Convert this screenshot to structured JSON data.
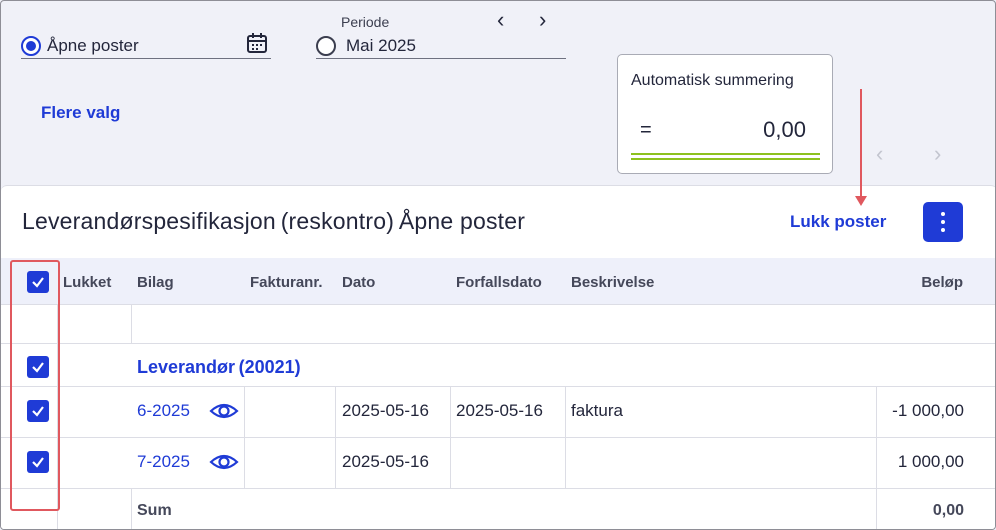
{
  "filters": {
    "open_posts_label": "Åpne poster",
    "period_caption": "Periode",
    "period_value": "Mai 2025",
    "more_options": "Flere valg"
  },
  "summary": {
    "title": "Automatisk summering",
    "operator": "=",
    "value": "0,00"
  },
  "panel": {
    "title": "Leverandørspesifikasjon (reskontro) Åpne poster",
    "close_posts": "Lukk poster"
  },
  "columns": [
    "Lukket",
    "Bilag",
    "Fakturanr.",
    "Dato",
    "Forfallsdato",
    "Beskrivelse",
    "Beløp"
  ],
  "group": {
    "label": "Leverandør (20021)"
  },
  "rows": [
    {
      "bilag": "6-2025",
      "fakturanr": "",
      "dato": "2025-05-16",
      "forfallsdato": "2025-05-16",
      "beskrivelse": "faktura",
      "belop": "-1 000,00"
    },
    {
      "bilag": "7-2025",
      "fakturanr": "",
      "dato": "2025-05-16",
      "forfallsdato": "",
      "beskrivelse": "",
      "belop": "1 000,00"
    }
  ],
  "sum_row": {
    "label": "Sum",
    "value": "0,00"
  },
  "colors": {
    "accent": "#1f3bd6",
    "annotation": "#e0585e",
    "summary_line": "#8ec21f"
  },
  "icons": [
    "calendar-icon",
    "chevron-left-icon",
    "chevron-right-icon",
    "eye-icon",
    "checkmark-icon",
    "kebab-menu-icon"
  ]
}
